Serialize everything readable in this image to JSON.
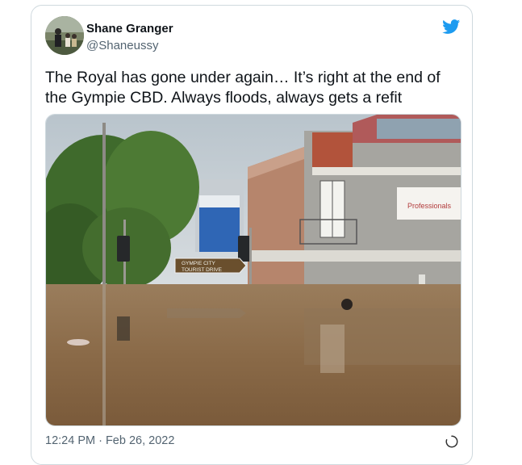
{
  "tweet": {
    "author_name": "Shane Granger",
    "author_handle": "@Shaneussy",
    "text": "The Royal has gone under again… It’s right at the end of the Gympie CBD. Always floods, always gets a refit",
    "timestamp": "12:24 PM · Feb 26, 2022"
  },
  "photo_signs": {
    "street_sign_line1": "GYMPIE CITY",
    "street_sign_line2": "TOURIST DRIVE",
    "building_sign": "Professionals"
  },
  "colors": {
    "brand_twitter": "#1d9bf0",
    "text_primary": "#0f1419",
    "text_secondary": "#536471",
    "border": "#cfd9de"
  },
  "icons": {
    "brand": "twitter-bird-icon",
    "corner": "loading-spinner-icon"
  }
}
